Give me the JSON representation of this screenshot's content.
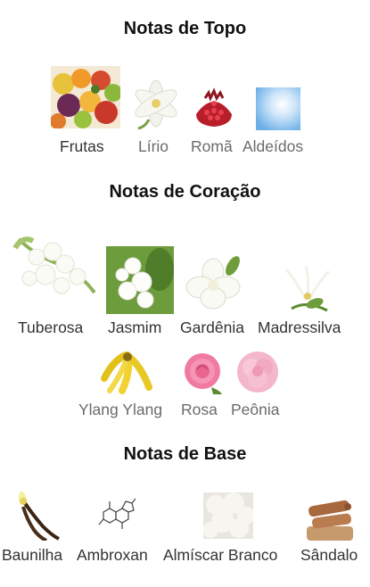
{
  "sections": [
    {
      "title": "Notas de Topo",
      "notes": [
        {
          "label": "Frutas",
          "icon": "fruits-icon"
        },
        {
          "label": "Lírio",
          "icon": "lily-icon"
        },
        {
          "label": "Romã",
          "icon": "pomegranate-icon"
        },
        {
          "label": "Aldeídos",
          "icon": "aldehydes-sky-icon"
        }
      ]
    },
    {
      "title": "Notas de Coração",
      "notes": [
        {
          "label": "Tuberosa",
          "icon": "tuberose-icon"
        },
        {
          "label": "Jasmim",
          "icon": "jasmine-icon"
        },
        {
          "label": "Gardênia",
          "icon": "gardenia-icon"
        },
        {
          "label": "Madressilva",
          "icon": "honeysuckle-icon"
        },
        {
          "label": "Ylang Ylang",
          "icon": "ylang-ylang-icon"
        },
        {
          "label": "Rosa",
          "icon": "rose-icon"
        },
        {
          "label": "Peônia",
          "icon": "peony-icon"
        }
      ]
    },
    {
      "title": "Notas de Base",
      "notes": [
        {
          "label": "Baunilha",
          "icon": "vanilla-icon"
        },
        {
          "label": "Ambroxan",
          "icon": "ambroxan-molecule-icon"
        },
        {
          "label": "Almíscar Branco",
          "icon": "white-musk-icon"
        },
        {
          "label": "Sândalo",
          "icon": "sandalwood-icon"
        }
      ]
    }
  ],
  "colors": {
    "title": "#111111",
    "label": "#333333",
    "label_faded": "#6b6b6b"
  }
}
